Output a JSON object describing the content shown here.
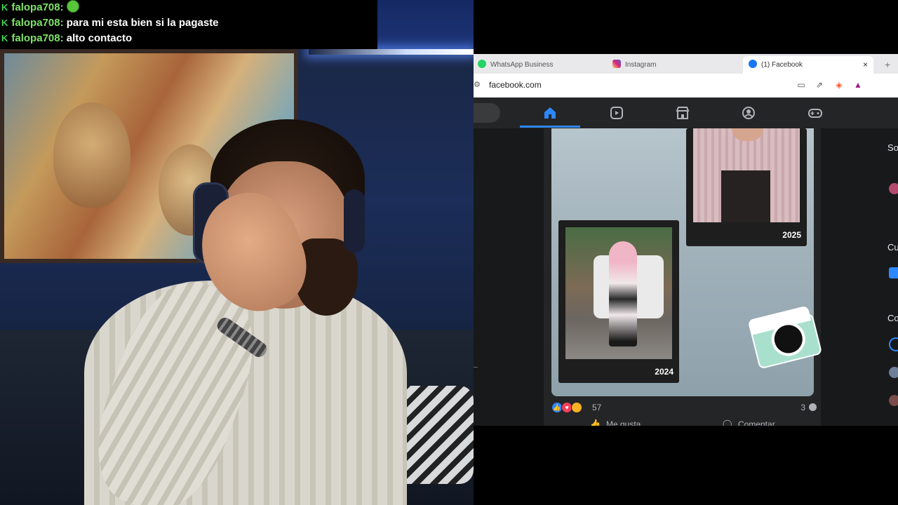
{
  "chat": {
    "messages": [
      {
        "user": "falopa708",
        "text": ""
      },
      {
        "user": "falopa708",
        "text": "para mi esta bien si la pagaste"
      },
      {
        "user": "falopa708",
        "text": "alto contacto"
      }
    ],
    "badge_icon": "kick-badge-icon",
    "emote_icon": "green-emote-icon"
  },
  "browser": {
    "tabs": [
      {
        "label": "WhatsApp Business",
        "icon": "whatsapp-icon",
        "color": "#25d366"
      },
      {
        "label": "Instagram",
        "icon": "instagram-icon",
        "color": "#d62976"
      },
      {
        "label": "(1) Facebook",
        "icon": "facebook-icon",
        "color": "#1877f2",
        "active": true
      }
    ],
    "new_tab_label": "+",
    "close_label": "×",
    "url": "facebook.com"
  },
  "fb": {
    "nav": [
      "home-icon",
      "reels-icon",
      "marketplace-icon",
      "groups-icon",
      "gaming-icon"
    ],
    "post": {
      "photos": [
        {
          "year": "2025"
        },
        {
          "year": "2024"
        }
      ],
      "reaction_count": "57",
      "comment_count": "3",
      "actions": {
        "like": "Me gusta",
        "comment": "Comentar"
      }
    },
    "right_column": {
      "headings": [
        "So",
        "Cu",
        "Co"
      ]
    }
  },
  "colors": {
    "fb_blue": "#2d88ff",
    "chat_username": "#7fe36a",
    "fb_dark": "#242526"
  }
}
